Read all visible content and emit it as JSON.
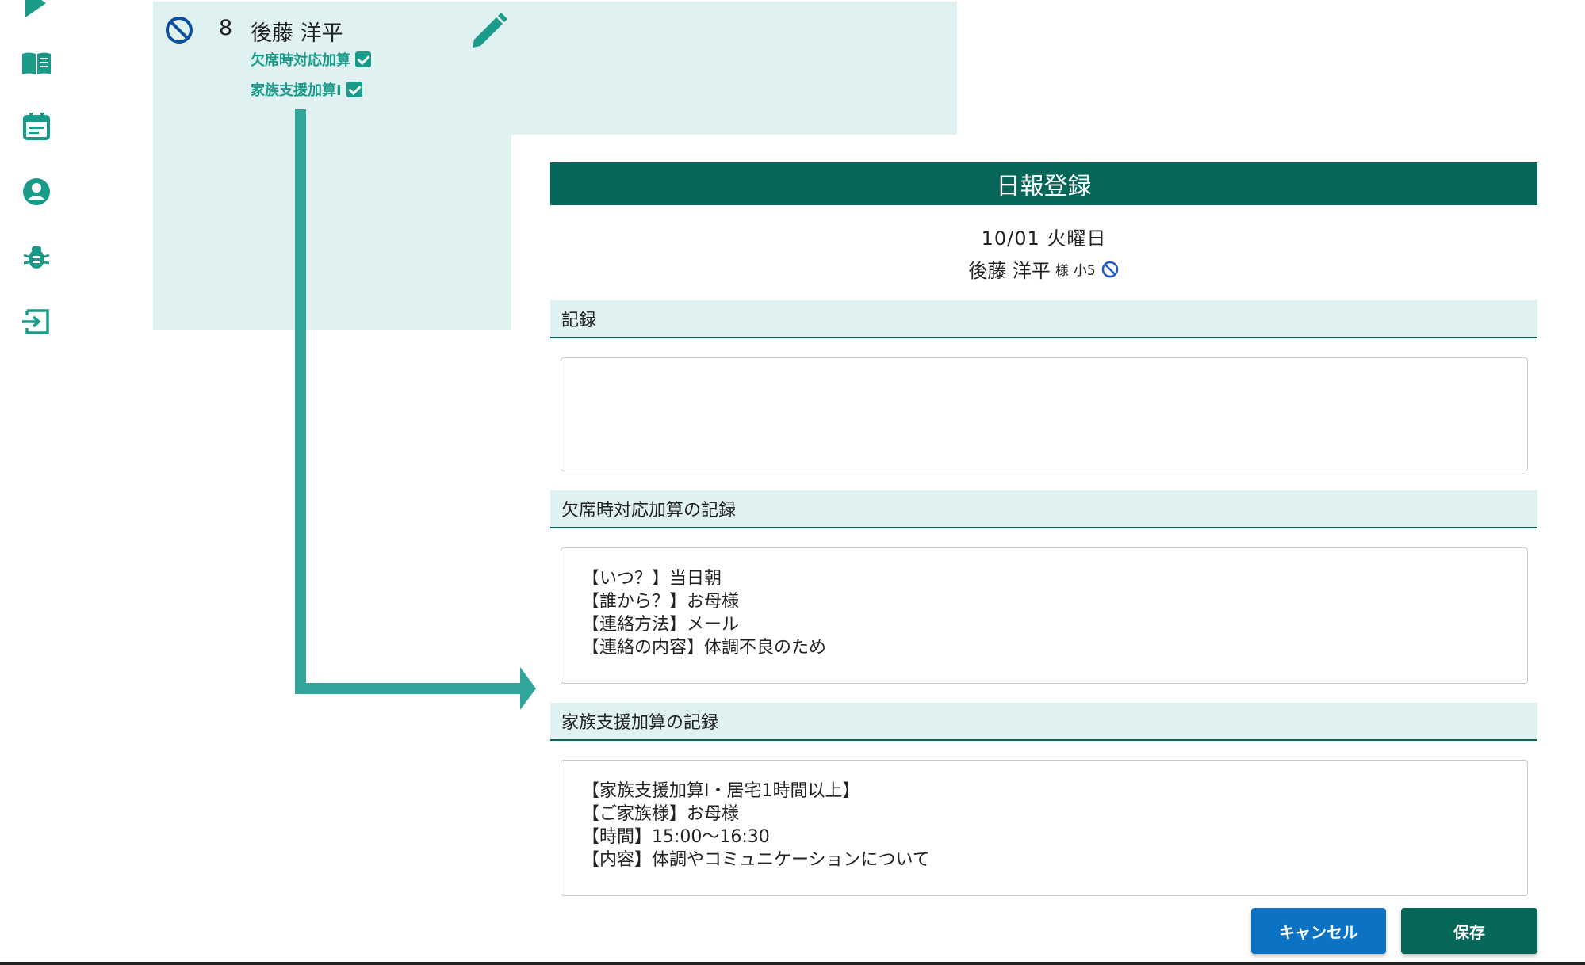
{
  "sidebar": {
    "items": [
      {
        "icon": "book-icon"
      },
      {
        "icon": "calendar-icon"
      },
      {
        "icon": "user-icon"
      },
      {
        "icon": "bug-icon"
      },
      {
        "icon": "logout-icon"
      }
    ]
  },
  "row": {
    "number": "8",
    "name": "後藤 洋平",
    "addons": [
      "欠席時対応加算",
      "家族支援加算Ⅰ"
    ]
  },
  "dialog": {
    "title": "日報登録",
    "date": "10/01 火曜日",
    "user_name": "後藤 洋平",
    "honorific": "様",
    "grade": "小5",
    "sections": [
      {
        "label": "記録",
        "text": ""
      },
      {
        "label": "欠席時対応加算の記録",
        "text": "【いつ？】当日朝\n【誰から？】お母様\n【連絡方法】メール\n【連絡の内容】体調不良のため"
      },
      {
        "label": "家族支援加算の記録",
        "text": "【家族支援加算Ⅰ・居宅1時間以上】\n【ご家族様】お母様\n【時間】15:00〜16:30\n【内容】体調やコミュニケーションについて"
      }
    ],
    "cancel_label": "キャンセル",
    "save_label": "保存"
  },
  "colors": {
    "accent": "#066657",
    "teal": "#2fa699",
    "light_bg": "#dff1f0",
    "cancel": "#0b72c4"
  }
}
